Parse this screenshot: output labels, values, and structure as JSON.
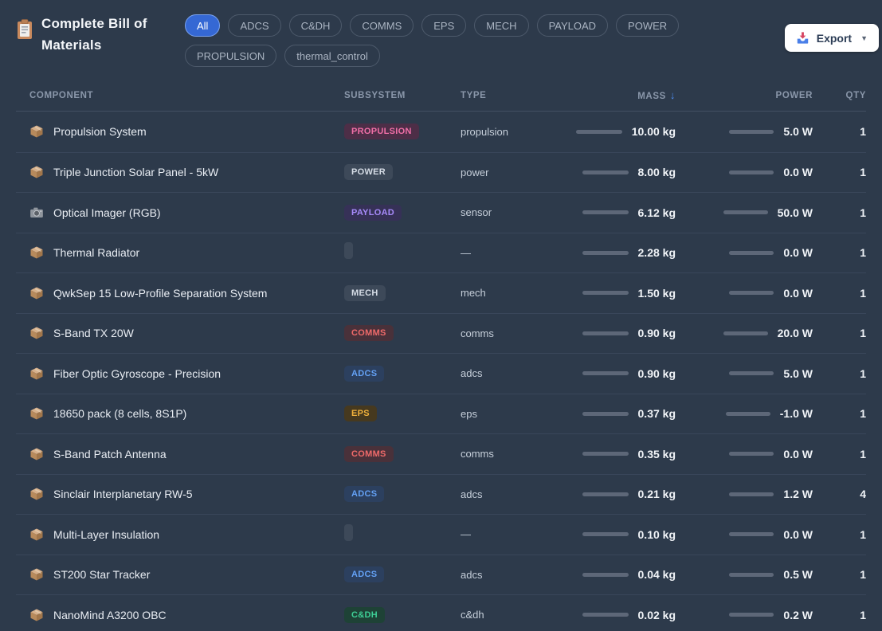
{
  "header": {
    "title": "Complete Bill of Materials",
    "export_label": "Export",
    "export_caret": "▼"
  },
  "filters": {
    "chips": [
      {
        "label": "All",
        "active": true
      },
      {
        "label": "ADCS",
        "active": false
      },
      {
        "label": "C&DH",
        "active": false
      },
      {
        "label": "COMMS",
        "active": false
      },
      {
        "label": "EPS",
        "active": false
      },
      {
        "label": "MECH",
        "active": false
      },
      {
        "label": "PAYLOAD",
        "active": false
      },
      {
        "label": "POWER",
        "active": false
      },
      {
        "label": "PROPULSION",
        "active": false
      },
      {
        "label": "thermal_control",
        "active": false
      }
    ]
  },
  "table": {
    "columns": [
      "COMPONENT",
      "SUBSYSTEM",
      "TYPE",
      "MASS",
      "POWER",
      "QTY"
    ],
    "sort_column": "MASS",
    "sort_arrow": "↓",
    "rows": [
      {
        "component": "Propulsion System",
        "icon": "package",
        "subsystem": "PROPULSION",
        "badge": "propulsion",
        "type": "propulsion",
        "mass": "10.00 kg",
        "power": "5.0 W",
        "qty": "1"
      },
      {
        "component": "Triple Junction Solar Panel - 5kW",
        "icon": "package",
        "subsystem": "POWER",
        "badge": "power",
        "type": "power",
        "mass": "8.00 kg",
        "power": "0.0 W",
        "qty": "1"
      },
      {
        "component": "Optical Imager (RGB)",
        "icon": "camera",
        "subsystem": "PAYLOAD",
        "badge": "payload",
        "type": "sensor",
        "mass": "6.12 kg",
        "power": "50.0 W",
        "qty": "1"
      },
      {
        "component": "Thermal Radiator",
        "icon": "package",
        "subsystem": "",
        "badge": "empty",
        "type": "—",
        "mass": "2.28 kg",
        "power": "0.0 W",
        "qty": "1"
      },
      {
        "component": "QwkSep 15 Low-Profile Separation System",
        "icon": "package",
        "subsystem": "MECH",
        "badge": "mech",
        "type": "mech",
        "mass": "1.50 kg",
        "power": "0.0 W",
        "qty": "1"
      },
      {
        "component": "S-Band TX 20W",
        "icon": "package",
        "subsystem": "COMMS",
        "badge": "comms",
        "type": "comms",
        "mass": "0.90 kg",
        "power": "20.0 W",
        "qty": "1"
      },
      {
        "component": "Fiber Optic Gyroscope - Precision",
        "icon": "package",
        "subsystem": "ADCS",
        "badge": "adcs",
        "type": "adcs",
        "mass": "0.90 kg",
        "power": "5.0 W",
        "qty": "1"
      },
      {
        "component": "18650 pack (8 cells, 8S1P)",
        "icon": "package",
        "subsystem": "EPS",
        "badge": "eps",
        "type": "eps",
        "mass": "0.37 kg",
        "power": "-1.0 W",
        "qty": "1"
      },
      {
        "component": "S-Band Patch Antenna",
        "icon": "package",
        "subsystem": "COMMS",
        "badge": "comms",
        "type": "comms",
        "mass": "0.35 kg",
        "power": "0.0 W",
        "qty": "1"
      },
      {
        "component": "Sinclair Interplanetary RW-5",
        "icon": "package",
        "subsystem": "ADCS",
        "badge": "adcs",
        "type": "adcs",
        "mass": "0.21 kg",
        "power": "1.2 W",
        "qty": "4"
      },
      {
        "component": "Multi-Layer Insulation",
        "icon": "package",
        "subsystem": "",
        "badge": "empty",
        "type": "—",
        "mass": "0.10 kg",
        "power": "0.0 W",
        "qty": "1"
      },
      {
        "component": "ST200 Star Tracker",
        "icon": "package",
        "subsystem": "ADCS",
        "badge": "adcs",
        "type": "adcs",
        "mass": "0.04 kg",
        "power": "0.5 W",
        "qty": "1"
      },
      {
        "component": "NanoMind A3200 OBC",
        "icon": "package",
        "subsystem": "C&DH",
        "badge": "cdh",
        "type": "c&dh",
        "mass": "0.02 kg",
        "power": "0.2 W",
        "qty": "1"
      }
    ]
  },
  "colors": {
    "background": "#2d3a4b",
    "accent_blue": "#3568d4",
    "sort_arrow_blue": "#4f8df2",
    "badge_propulsion": "#f06fa7",
    "badge_payload": "#a78bfa",
    "badge_comms": "#ef6a6a",
    "badge_adcs": "#64a1f5",
    "badge_eps": "#f0b13c",
    "badge_cdh": "#3ecf96",
    "bar_fill": "#5d6778"
  }
}
